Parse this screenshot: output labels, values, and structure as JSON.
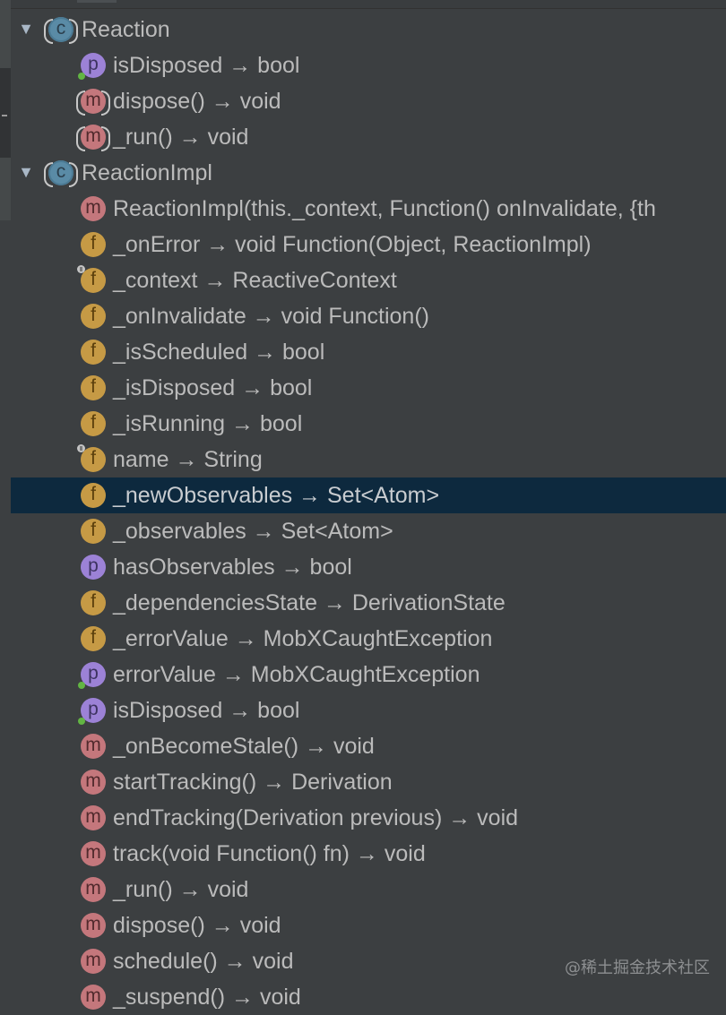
{
  "structure": {
    "rows": [
      {
        "kind": "class",
        "icon_letter": "c",
        "text": "Reaction",
        "level": 0,
        "expanded": true
      },
      {
        "kind": "property",
        "icon_letter": "p",
        "text": "isDisposed → bool",
        "level": 1,
        "public": true
      },
      {
        "kind": "method",
        "icon_letter": "m",
        "text": "dispose() → void",
        "level": 1,
        "bracketed": true
      },
      {
        "kind": "method",
        "icon_letter": "m",
        "text": "_run() → void",
        "level": 1,
        "bracketed": true
      },
      {
        "kind": "class",
        "icon_letter": "c",
        "text": "ReactionImpl",
        "level": 0,
        "expanded": true
      },
      {
        "kind": "method",
        "icon_letter": "m",
        "text": "ReactionImpl(this._context,  Function() onInvalidate, {th",
        "level": 1
      },
      {
        "kind": "field",
        "icon_letter": "f",
        "text": "_onError → void Function(Object, ReactionImpl)",
        "level": 1
      },
      {
        "kind": "field",
        "icon_letter": "f",
        "text": "_context → ReactiveContext",
        "level": 1,
        "final": true
      },
      {
        "kind": "field",
        "icon_letter": "f",
        "text": "_onInvalidate → void Function()",
        "level": 1
      },
      {
        "kind": "field",
        "icon_letter": "f",
        "text": "_isScheduled → bool",
        "level": 1
      },
      {
        "kind": "field",
        "icon_letter": "f",
        "text": "_isDisposed → bool",
        "level": 1
      },
      {
        "kind": "field",
        "icon_letter": "f",
        "text": "_isRunning → bool",
        "level": 1
      },
      {
        "kind": "field",
        "icon_letter": "f",
        "text": "name → String",
        "level": 1,
        "final": true
      },
      {
        "kind": "field",
        "icon_letter": "f",
        "text": "_newObservables → Set<Atom>",
        "level": 1,
        "selected": true
      },
      {
        "kind": "field",
        "icon_letter": "f",
        "text": "_observables → Set<Atom>",
        "level": 1
      },
      {
        "kind": "property",
        "icon_letter": "p",
        "text": "hasObservables → bool",
        "level": 1
      },
      {
        "kind": "field",
        "icon_letter": "f",
        "text": "_dependenciesState → DerivationState",
        "level": 1
      },
      {
        "kind": "field",
        "icon_letter": "f",
        "text": "_errorValue → MobXCaughtException",
        "level": 1
      },
      {
        "kind": "property",
        "icon_letter": "p",
        "text": "errorValue → MobXCaughtException",
        "level": 1,
        "public": true
      },
      {
        "kind": "property",
        "icon_letter": "p",
        "text": "isDisposed → bool",
        "level": 1,
        "public": true
      },
      {
        "kind": "method",
        "icon_letter": "m",
        "text": "_onBecomeStale() → void",
        "level": 1
      },
      {
        "kind": "method",
        "icon_letter": "m",
        "text": "startTracking() → Derivation",
        "level": 1
      },
      {
        "kind": "method",
        "icon_letter": "m",
        "text": "endTracking(Derivation previous) → void",
        "level": 1
      },
      {
        "kind": "method",
        "icon_letter": "m",
        "text": "track(void Function() fn) → void",
        "level": 1
      },
      {
        "kind": "method",
        "icon_letter": "m",
        "text": "_run() → void",
        "level": 1
      },
      {
        "kind": "method",
        "icon_letter": "m",
        "text": "dispose() → void",
        "level": 1
      },
      {
        "kind": "method",
        "icon_letter": "m",
        "text": "schedule() → void",
        "level": 1
      },
      {
        "kind": "method",
        "icon_letter": "m",
        "text": "_suspend() → void",
        "level": 1
      }
    ]
  },
  "expand_arrow": "▼",
  "watermark": "@稀土掘金技术社区",
  "colors": {
    "background": "#3c3f41",
    "selection": "#0d293e",
    "class_icon": "#5a8ba6",
    "property_icon": "#9c82d6",
    "method_icon": "#c4777c",
    "field_icon": "#c69a45",
    "public_dot": "#62b543"
  }
}
